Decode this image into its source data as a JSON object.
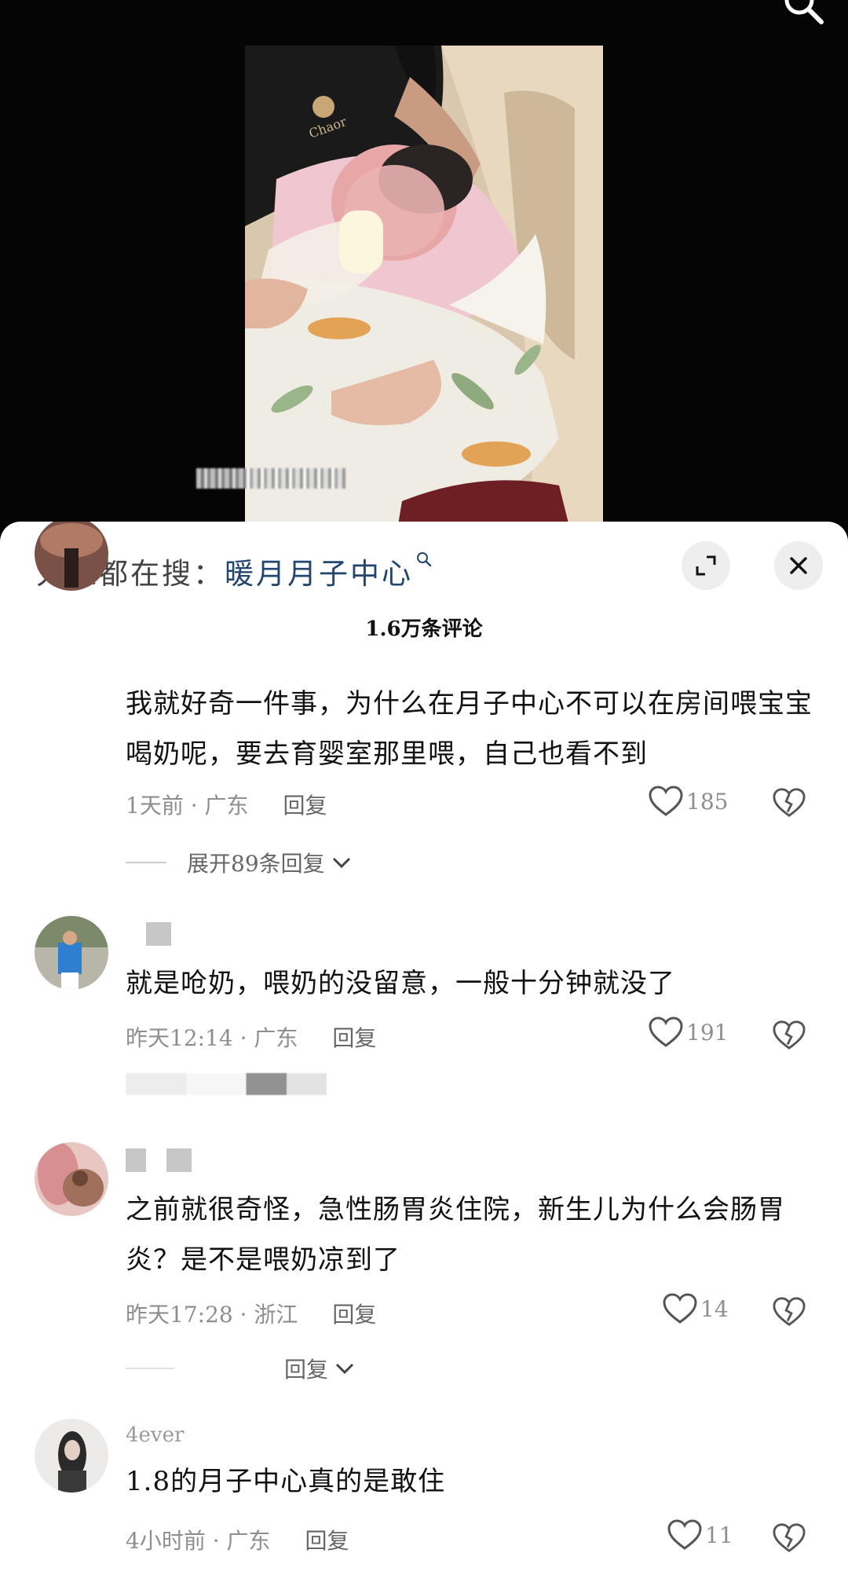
{
  "search_suggest": {
    "prefix": "大家都在搜：",
    "keyword": "暖月月子中心"
  },
  "comments_header": {
    "count": "1.6万条评论"
  },
  "comments": [
    {
      "text": "我就好奇一件事，为什么在月子中心不可以在房间喂宝宝喝奶呢，要去育婴室那里喂，自己也看不到",
      "time": "1天前",
      "location": "广东",
      "reply_label": "回复",
      "likes": "185",
      "expand_label": "展开89条回复"
    },
    {
      "text": "就是呛奶，喂奶的没留意，一般十分钟就没了",
      "time": "昨天12:14",
      "location": "广东",
      "reply_label": "回复",
      "likes": "191"
    },
    {
      "text": "之前就很奇怪，急性肠胃炎住院，新生儿为什么会肠胃炎？是不是喂奶凉到了",
      "time": "昨天17:28",
      "location": "浙江",
      "reply_label": "回复",
      "likes": "14",
      "expand_label": "回复"
    },
    {
      "username": "4ever",
      "text": "1.8的月子中心真的是敢住",
      "time": "4小时前",
      "location": "广东",
      "reply_label": "回复",
      "likes": "11"
    }
  ],
  "colors": {
    "keyword": "#23466e",
    "sheet_bg": "#ffffff",
    "meta_gray": "#8e8e8e"
  },
  "icons": [
    "search-icon",
    "expand-icon",
    "close-icon",
    "heart-icon",
    "broken-heart-icon",
    "chevron-down-icon"
  ]
}
